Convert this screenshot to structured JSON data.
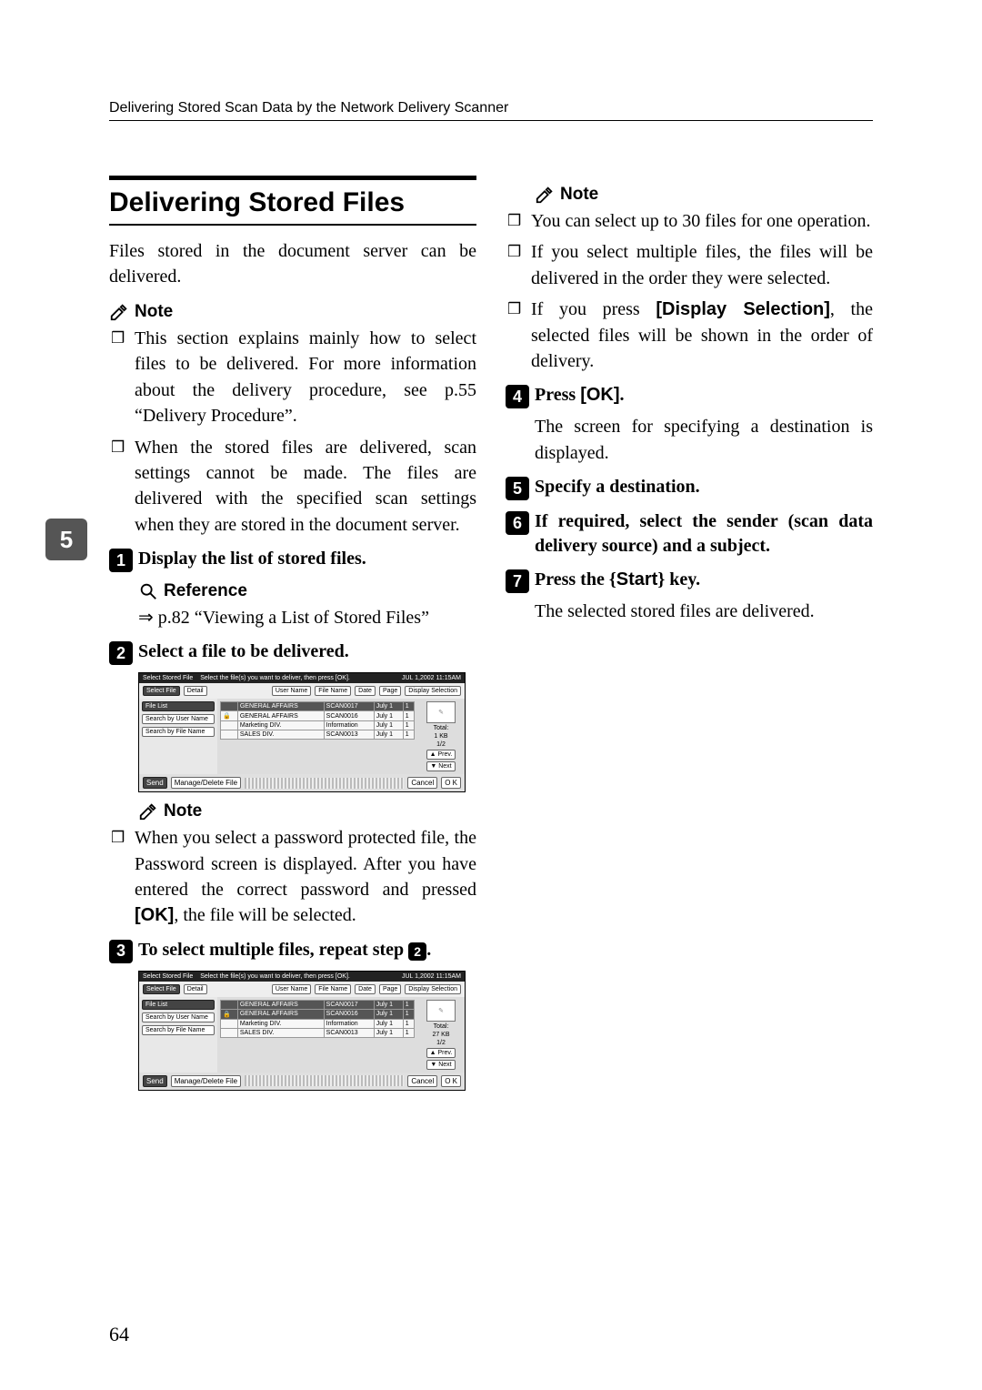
{
  "running_head": "Delivering Stored Scan Data by the Network Delivery Scanner",
  "side_tab": "5",
  "page_number": "64",
  "section_title": "Delivering Stored Files",
  "lead": "Files stored in the document server can be delivered.",
  "labels": {
    "note": "Note",
    "reference": "Reference"
  },
  "left": {
    "note1_items": [
      "This section explains mainly how to select files to be delivered. For more information about the delivery procedure, see p.55 “Delivery Procedure”.",
      "When the stored files are delivered, scan settings cannot be made. The files are delivered with the specified scan settings when they are stored in the document server."
    ],
    "step1": {
      "num": "1",
      "text": "Display the list of stored files."
    },
    "ref_text": "⇒ p.82 “Viewing a List of Stored Files”",
    "step2": {
      "num": "2",
      "text": "Select a file to be delivered."
    },
    "note2_items": [
      "When you select a password protected file, the Password screen is displayed. After you have entered the correct password and pressed [OK], the file will be selected."
    ],
    "note2_ok": "[OK]",
    "step3": {
      "num": "3",
      "text_a": "To select multiple files, repeat step ",
      "ref_num": "2",
      "text_b": "."
    }
  },
  "right": {
    "note_items_plain": [
      "You can select up to 30 files for one operation.",
      "If you select multiple files, the files will be delivered in the order they were selected."
    ],
    "note_item_disp_a": "If you press ",
    "note_item_disp_btn": "[Display Selection]",
    "note_item_disp_b": ", the selected files will be shown in the order of delivery.",
    "step4": {
      "num": "4",
      "text_a": "Press ",
      "btn": "[OK]",
      "text_b": "."
    },
    "step4_body": "The screen for specifying a destination is displayed.",
    "step5": {
      "num": "5",
      "text": "Specify a destination."
    },
    "step6": {
      "num": "6",
      "text": "If required, select the sender (scan data delivery source) and a subject."
    },
    "step7": {
      "num": "7",
      "text_a": "Press the ",
      "key_open": "{",
      "key": "Start",
      "key_close": "}",
      "text_b": " key."
    },
    "step7_body": "The selected stored files are delivered."
  },
  "shot": {
    "titlebar_left": "Select Stored File",
    "titlebar_mid": "Select the file(s) you want to deliver, then press [OK].",
    "titlebar_right": "JUL   1,2002 11:15AM",
    "toolbar": {
      "select_file": "Select File",
      "detail": "Detail",
      "user_name": "User Name",
      "file_name": "File Name",
      "date": "Date",
      "page": "Page",
      "display_selection": "Display Selection"
    },
    "left_buttons": [
      "File List",
      "Search by User Name",
      "Search by File Name"
    ],
    "rows": [
      {
        "lock": "",
        "user": "GENERAL AFFAIRS",
        "file": "SCAN0017",
        "date": "July   1",
        "page": "1"
      },
      {
        "lock": "🔒",
        "user": "GENERAL AFFAIRS",
        "file": "SCAN0016",
        "date": "July   1",
        "page": "1"
      },
      {
        "lock": "",
        "user": "Marketing DIV.",
        "file": "Information",
        "date": "July   1",
        "page": "1"
      },
      {
        "lock": "",
        "user": "SALES DIV.",
        "file": "SCAN0013",
        "date": "July   1",
        "page": "1"
      }
    ],
    "side": {
      "total_label": "Total:",
      "total1": "1 KB",
      "total2": "27 KB",
      "pager": "1/2",
      "prev": "▲ Prev.",
      "next": "▼ Next"
    },
    "footer": {
      "send": "Send",
      "manage": "Manage/Delete File",
      "cancel": "Cancel",
      "ok": "O K"
    }
  }
}
